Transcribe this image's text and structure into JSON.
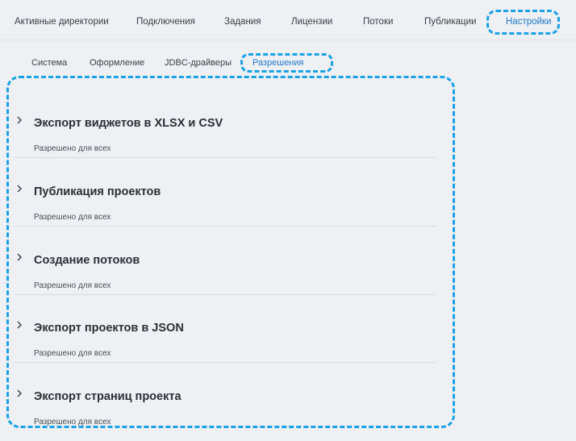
{
  "top_tabs": [
    {
      "label": "Активные директории"
    },
    {
      "label": "Подключения"
    },
    {
      "label": "Задания"
    },
    {
      "label": "Лицензии"
    },
    {
      "label": "Потоки"
    },
    {
      "label": "Публикации"
    },
    {
      "label": "Настройки",
      "active": true
    }
  ],
  "sub_tabs": [
    {
      "label": "Система"
    },
    {
      "label": "Оформление"
    },
    {
      "label": "JDBC-драйверы"
    },
    {
      "label": "Разрешения",
      "active": true
    }
  ],
  "permissions": [
    {
      "title": "Экспорт виджетов в XLSX и CSV",
      "status": "Разрешено для всех"
    },
    {
      "title": "Публикация проектов",
      "status": "Разрешено для всех"
    },
    {
      "title": "Создание потоков",
      "status": "Разрешено для всех"
    },
    {
      "title": "Экспорт проектов в JSON",
      "status": "Разрешено для всех"
    },
    {
      "title": "Экспорт страниц проекта",
      "status": "Разрешено для всех"
    }
  ],
  "colors": {
    "accent": "#1f79c8",
    "highlight": "#1aa2e6",
    "background": "#eef0f3"
  },
  "icons": {
    "expand": "chevron-right-icon"
  }
}
